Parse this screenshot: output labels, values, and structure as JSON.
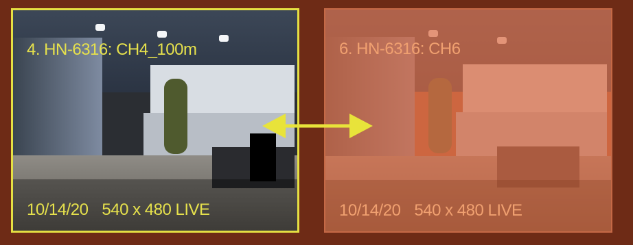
{
  "tiles": [
    {
      "camera_label": "4. HN-6316: CH4_100m",
      "date_text": "10/14/20",
      "resolution_text": "540 x 480 LIVE",
      "selected": true,
      "border_color": "#e5e043"
    },
    {
      "camera_label": "6. HN-6316: CH6",
      "date_text": "10/14/20",
      "resolution_text": "540 x 480 LIVE",
      "selected": false,
      "overlay_color": "#dc6e46"
    }
  ],
  "swap_arrow": {
    "icon": "double-arrow-icon",
    "color": "#e8e33a"
  }
}
